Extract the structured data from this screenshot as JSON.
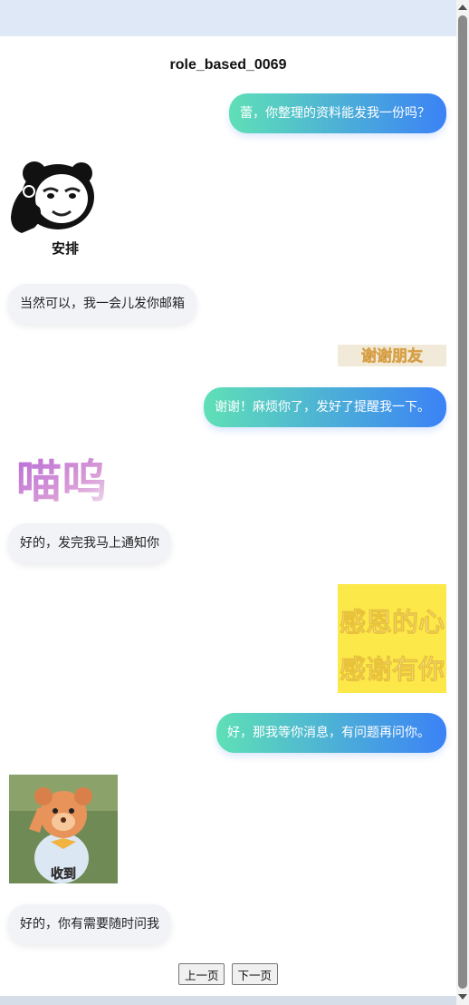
{
  "title": "role_based_0069",
  "messages": [
    {
      "text": "蕾，你整理的资料能发我一份吗？"
    },
    {
      "sticker_caption": "安排"
    },
    {
      "text": "当然可以，我一会儿发你邮箱"
    },
    {
      "sticker_caption": "谢谢朋友"
    },
    {
      "text": "谢谢！麻烦你了，发好了提醒我一下。"
    },
    {
      "sticker_caption": "喵呜"
    },
    {
      "text": "好的，发完我马上通知你"
    },
    {
      "sticker_caption_line1": "感恩的心",
      "sticker_caption_line2": "感谢有你"
    },
    {
      "text": "好，那我等你消息，有问题再问你。"
    },
    {
      "sticker_caption": "收到"
    },
    {
      "text": "好的，你有需要随时问我"
    }
  ],
  "pager": {
    "prev_label": "上一页",
    "next_label": "下一页"
  },
  "colors": {
    "outgoing_start": "#5fe0b6",
    "outgoing_end": "#3b82f6",
    "incoming_bg": "#f1f3f7",
    "background": "#dde7f6"
  }
}
